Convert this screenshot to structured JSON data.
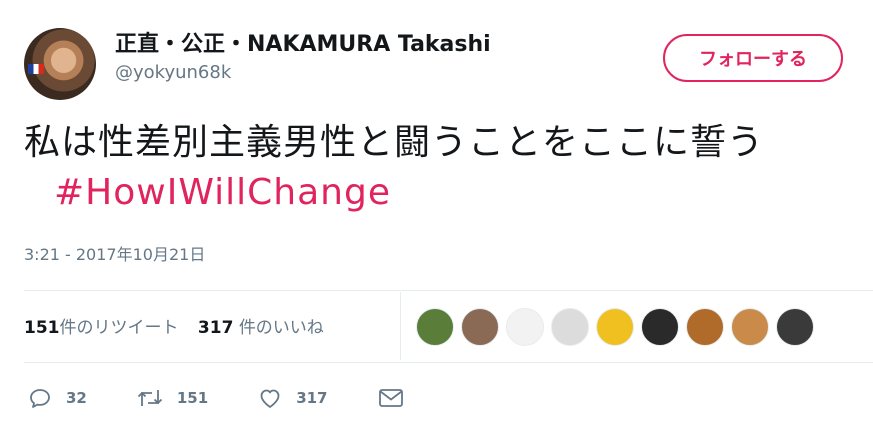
{
  "user": {
    "display_name": "正直・公正・NAKAMURA Takashi",
    "handle": "@yokyun68k",
    "avatar_icon": "avatar-icon"
  },
  "follow_button": {
    "label": "フォローする",
    "color": "#e0245e"
  },
  "tweet": {
    "text": "私は性差別主義男性と闘うことをここに誓う",
    "hashtag": "#HowIWillChange",
    "timestamp": "3:21 - 2017年10月21日"
  },
  "stats": {
    "retweets_count": "151",
    "retweets_label": "件のリツイート",
    "likes_count": "317",
    "likes_label": "件のいいね"
  },
  "likers": [
    {
      "color": "#5a7d3a"
    },
    {
      "color": "#8a6a55"
    },
    {
      "color": "#f2f2f2"
    },
    {
      "color": "#dcdcdc"
    },
    {
      "color": "#f0c020"
    },
    {
      "color": "#2a2a2a"
    },
    {
      "color": "#b06a2a"
    },
    {
      "color": "#c98a4a"
    },
    {
      "color": "#3a3a3a"
    }
  ],
  "actions": {
    "reply_count": "32",
    "retweet_count": "151",
    "like_count": "317"
  }
}
